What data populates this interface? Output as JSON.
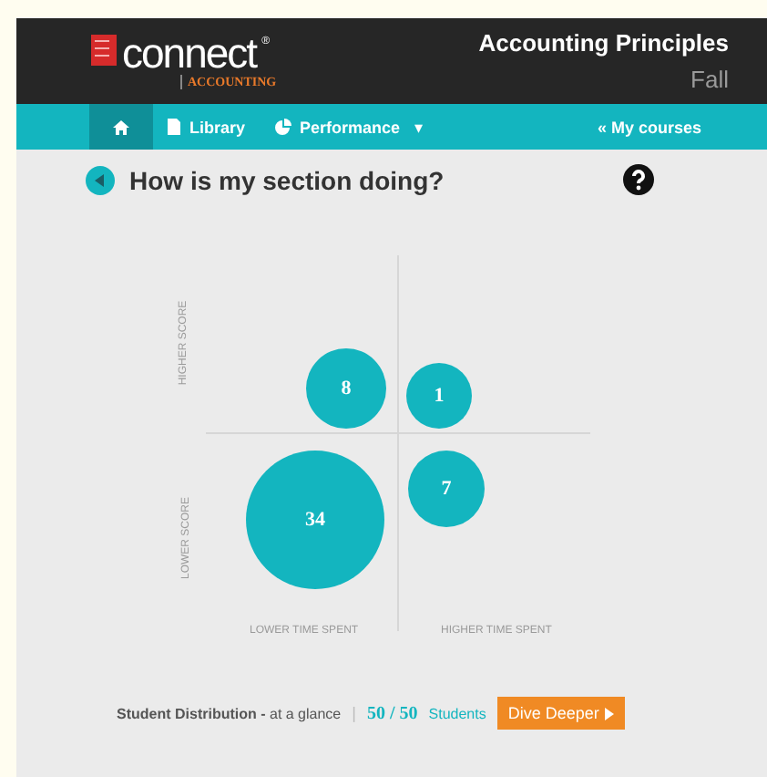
{
  "header": {
    "brand": "connect",
    "brand_mark": "®",
    "subbrand": "ACCOUNTING",
    "course_title": "Accounting Principles",
    "term": "Fall"
  },
  "nav": {
    "items": [
      {
        "kind": "home",
        "selected": true
      },
      {
        "kind": "library",
        "label": "Library",
        "selected": false
      },
      {
        "kind": "performance",
        "label": "Performance",
        "selected": false
      }
    ],
    "caret": "▾",
    "my_courses": "« My courses"
  },
  "section": {
    "title": "How is my section doing?"
  },
  "distribution": {
    "y_labels": [
      "HIGHER SCORE",
      "LOWER SCORE"
    ],
    "x_labels": [
      "LOWER TIME SPENT",
      "HIGHER TIME SPENT"
    ],
    "bubbles": [
      {
        "label": "8"
      },
      {
        "label": "1"
      },
      {
        "label": "7"
      },
      {
        "label": "34"
      }
    ]
  },
  "footer": {
    "summary": "**Student Distribution -** at a glance",
    "separator": "|",
    "count": "50 / 50",
    "count_unit": "Students",
    "button": "Dive Deeper"
  }
}
